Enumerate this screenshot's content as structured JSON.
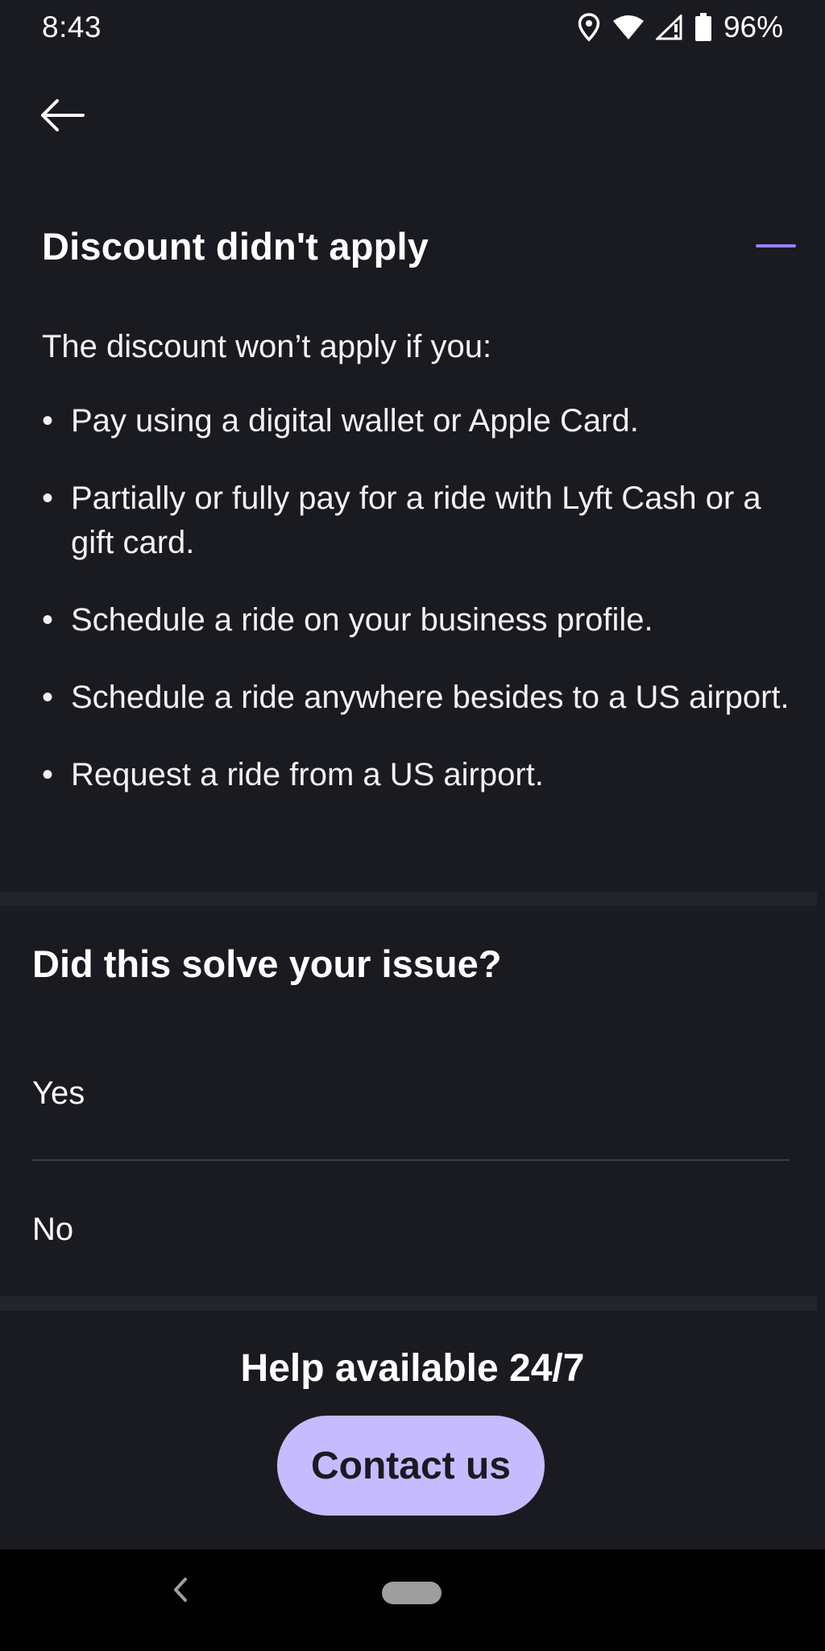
{
  "status_bar": {
    "time": "8:43",
    "battery_percent": "96%",
    "icons": [
      "location-icon",
      "wifi-icon",
      "signal-icon",
      "battery-icon"
    ]
  },
  "nav": {
    "back_icon": "arrow-left-icon"
  },
  "article": {
    "title": "Discount didn't apply",
    "collapse_icon": "minus-icon",
    "intro": "The discount won’t apply if you:",
    "items": [
      "Pay using a digital wallet or Apple Card.",
      "Partially or fully pay for a ride with Lyft Cash or a gift card.",
      "Schedule a ride on your business profile.",
      "Schedule a ride anywhere besides to a US airport.",
      "Request a ride from a US airport."
    ]
  },
  "feedback": {
    "question": "Did this solve your issue?",
    "options": [
      "Yes",
      "No"
    ]
  },
  "help": {
    "title": "Help available 24/7",
    "contact_label": "Contact us"
  },
  "system_nav": {
    "back_icon": "chevron-left-icon",
    "home_icon": "home-pill-icon"
  },
  "colors": {
    "background": "#1a1a21",
    "accent": "#9b7ef0",
    "button": "#c7bbff",
    "divider": "#24242c"
  }
}
